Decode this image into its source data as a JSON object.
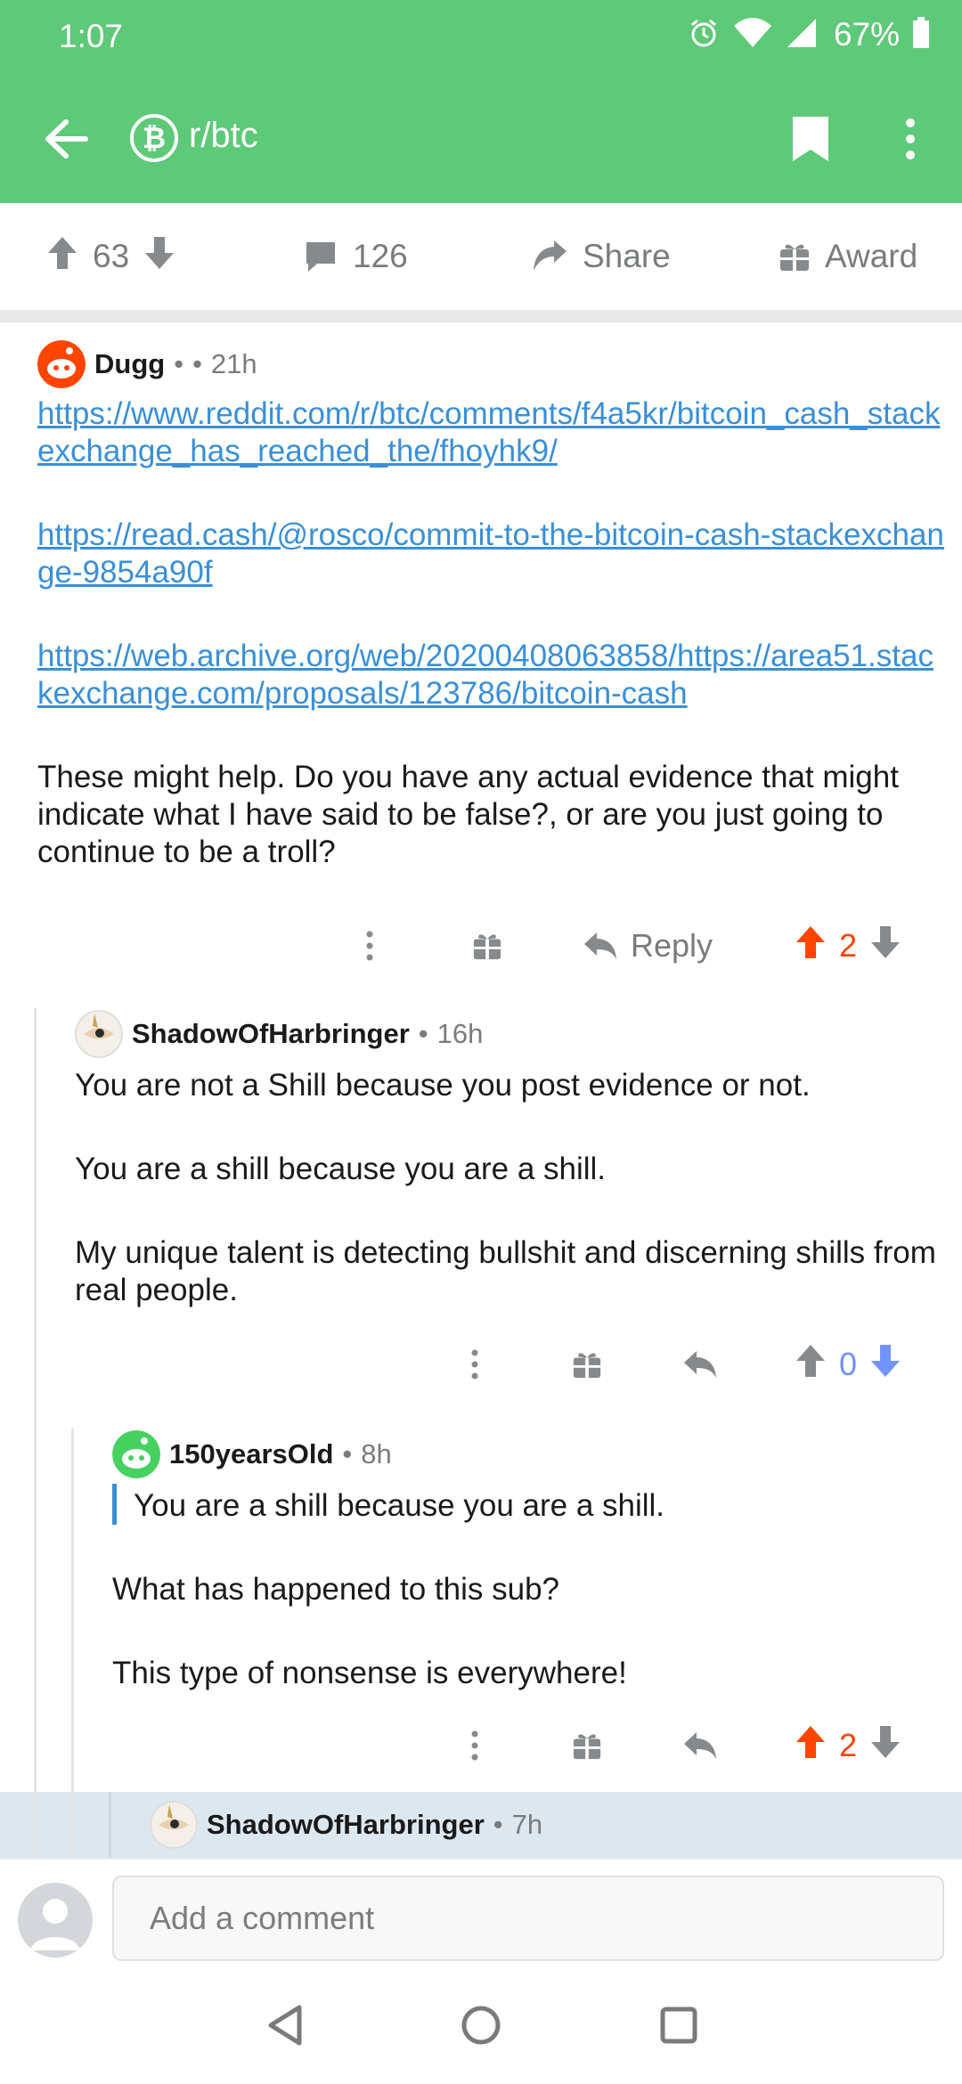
{
  "status_bar": {
    "time": "1:07",
    "battery": "67%"
  },
  "app_bar": {
    "subreddit": "r/btc",
    "sub_icon": "bitcoin-icon"
  },
  "post_actions": {
    "upvotes": "63",
    "comments": "126",
    "share_label": "Share",
    "award_label": "Award"
  },
  "comments": [
    {
      "user": "Dugg",
      "dot": "•",
      "extra_dot": "•",
      "age": "21h",
      "links": [
        "https://www.reddit.com/r/btc/comments/f4a5kr/bitcoin_cash_stackexchange_has_reached_the/fhoyhk9/",
        "https://read.cash/@rosco/commit-to-the-bitcoin-cash-stackexchange-9854a90f",
        "https://web.archive.org/web/20200408063858/https://area51.stackexchange.com/proposals/123786/bitcoin-cash"
      ],
      "text": "These might help. Do you have any actual evidence that might indicate what I have said to be false?, or are you just going to continue to be a troll?",
      "reply_label": "Reply",
      "score": "2",
      "vote_state": "up"
    },
    {
      "user": "ShadowOfHarbringer",
      "dot": "•",
      "age": "16h",
      "paragraphs": [
        "You are not a Shill because you post evidence or not.",
        "You are a shill because you are a shill.",
        "My unique talent is detecting bullshit and discerning shills from real people."
      ],
      "score": "0",
      "vote_state": "down"
    },
    {
      "user": "150yearsOld",
      "dot": "•",
      "age": "8h",
      "quote": "You are a shill because you are a shill.",
      "paragraphs": [
        "What has happened to this sub?",
        "This type of nonsense is everywhere!"
      ],
      "score": "2",
      "vote_state": "up"
    },
    {
      "user": "ShadowOfHarbringer",
      "dot": "•",
      "age": "7h"
    }
  ],
  "composer": {
    "placeholder": "Add a comment"
  },
  "colors": {
    "header": "#5ec979",
    "upvote": "#ff4500",
    "downvote": "#7193ff",
    "link": "#3a8fd6",
    "highlight": "#dde7f0"
  }
}
